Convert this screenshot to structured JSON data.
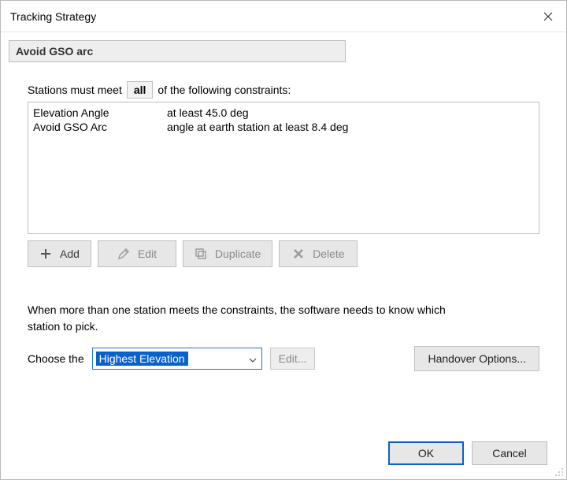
{
  "window": {
    "title": "Tracking Strategy"
  },
  "strategy": {
    "name": "Avoid GSO arc"
  },
  "constraints": {
    "sentence_pre": "Stations must meet",
    "quantifier": "all",
    "sentence_post": "of the following constraints:",
    "rows": [
      {
        "name": "Elevation Angle",
        "desc": "at least 45.0 deg"
      },
      {
        "name": "Avoid GSO Arc",
        "desc": "angle at earth station at least 8.4 deg"
      }
    ]
  },
  "toolbar": {
    "add": "Add",
    "edit": "Edit",
    "duplicate": "Duplicate",
    "delete": "Delete"
  },
  "picker": {
    "explain": "When more than one station meets the constraints, the software needs to know which station to pick.",
    "choose_label": "Choose the",
    "selected": "Highest Elevation",
    "edit_label": "Edit...",
    "handover_label": "Handover Options..."
  },
  "footer": {
    "ok": "OK",
    "cancel": "Cancel"
  }
}
